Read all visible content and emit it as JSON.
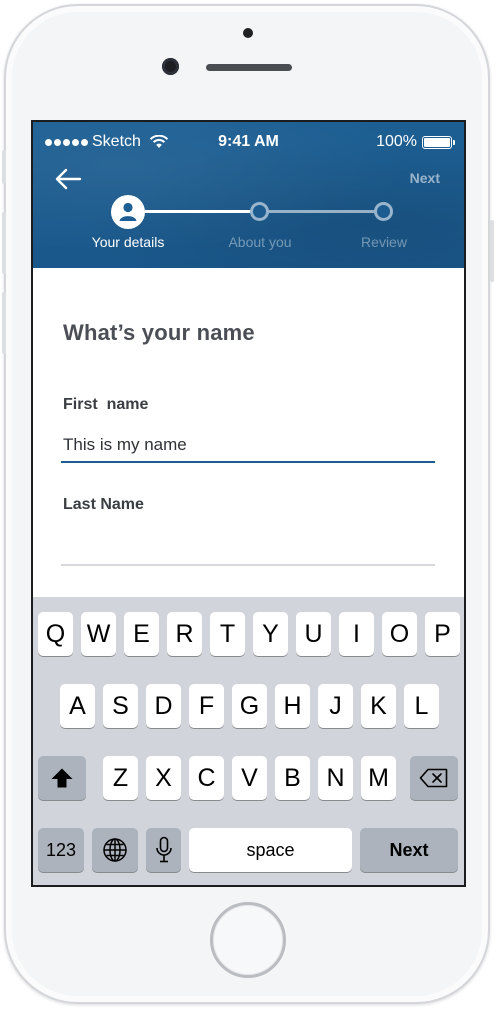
{
  "status_bar": {
    "carrier": "Sketch",
    "time": "9:41 AM",
    "battery": "100%"
  },
  "header": {
    "next_label": "Next",
    "steps": [
      {
        "label": "Your details",
        "state": "active"
      },
      {
        "label": "About you",
        "state": "inactive"
      },
      {
        "label": "Review",
        "state": "inactive"
      }
    ]
  },
  "form": {
    "title": "What’s your name",
    "first_name": {
      "label": "First  name",
      "value": "This is my name"
    },
    "last_name": {
      "label": "Last Name",
      "value": ""
    }
  },
  "keyboard": {
    "row1": [
      "Q",
      "W",
      "E",
      "R",
      "T",
      "Y",
      "U",
      "I",
      "O",
      "P"
    ],
    "row2": [
      "A",
      "S",
      "D",
      "F",
      "G",
      "H",
      "J",
      "K",
      "L"
    ],
    "row3": [
      "Z",
      "X",
      "C",
      "V",
      "B",
      "N",
      "M"
    ],
    "numbers_key": "123",
    "space_key": "space",
    "return_key": "Next",
    "icons": [
      "shift-icon",
      "backspace-icon",
      "globe-icon",
      "microphone-icon"
    ]
  },
  "colors": {
    "header_blue": "#1d5f93",
    "active_underline": "#1d5b91",
    "keyboard_bg": "#d1d5db",
    "dark_key": "#acb3bc"
  }
}
